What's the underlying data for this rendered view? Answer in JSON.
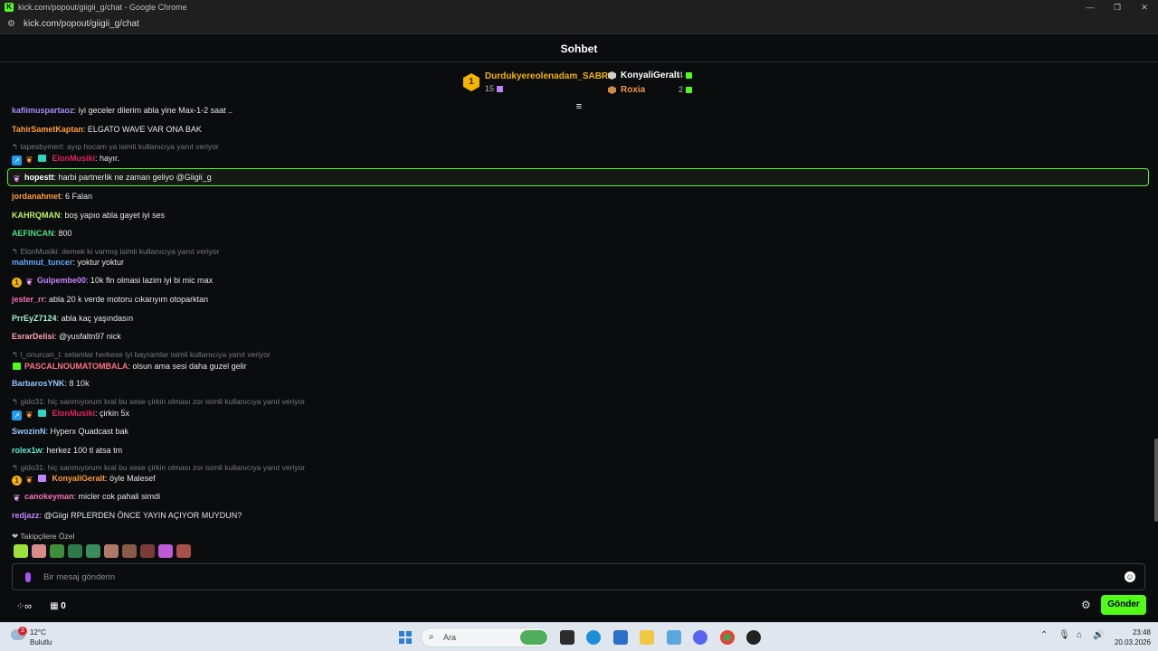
{
  "browser": {
    "window_title": "kick.com/popout/giigii_g/chat - Google Chrome",
    "url": "kick.com/popout/giigii_g/chat",
    "minimize": "—",
    "restore": "❐",
    "close": "✕",
    "favicon": "K"
  },
  "chat": {
    "header": "Sohbet",
    "leaderboard": {
      "first": {
        "rank": "1",
        "name": "Durdukyereolenadam_SABRI",
        "count": "15"
      },
      "second": {
        "name": "KonyaliGeralt",
        "count": "4"
      },
      "third": {
        "name": "Roxia",
        "count": "2"
      }
    },
    "messages": [
      {
        "user": "kafiimuspartaoz",
        "text": "iyi geceler dilerim abla yine Max-1-2 saat ..",
        "color": "#a78bfa"
      },
      {
        "user": "TahirSametKaptan",
        "text": "ELGATO WAVE VAR ONA BAK",
        "color": "#ff9b3d"
      },
      {
        "reply": "tapesbymert: ayıp hocam ya isimli kullanıcıya yanıt veriyor"
      },
      {
        "user": "ElonMusiki",
        "text": "hayır.",
        "color": "#e0245e"
      },
      {
        "user": "hopestt",
        "text": "harbi partnerlik ne zaman geliyo @Giigii_g",
        "color": "#ffffff"
      },
      {
        "user": "jordanahmet",
        "text": "6 Falan",
        "color": "#ff9b3d"
      },
      {
        "user": "KAHRQMAN",
        "text": "boş yapıo abla gayet iyi ses",
        "color": "#bef264"
      },
      {
        "user": "AEFINCAN",
        "text": "800",
        "color": "#4ade80"
      },
      {
        "reply": "ElonMusiki: demek ki varmış isimli kullanıcıya yanıt veriyor"
      },
      {
        "user": "mahmut_tuncer",
        "text": "yoktur yoktur",
        "color": "#60a5fa"
      },
      {
        "user": "Gulpembe00",
        "text": "10k fln olmasi lazim iyi bi mic max",
        "color": "#c084fc"
      },
      {
        "user": "jester_rr",
        "text": "abla 20 k verde motoru cıkarıyım otoparktan",
        "color": "#f472b6"
      },
      {
        "user": "PrrEyZ7124",
        "text": "abla kaç yaşındasın",
        "color": "#a7f3d0"
      },
      {
        "user": "EsrarDelisi",
        "text": "@yusfaltn97 nick",
        "color": "#fda4af"
      },
      {
        "reply": "l_onurcan_l: selamlar herkese iyi bayramlar isimli kullanıcıya yanıt veriyor"
      },
      {
        "user": "PASCALNOUMATOMBALA",
        "text": "olsun ama sesi daha guzel gelir",
        "color": "#fb7185"
      },
      {
        "user": "BarbarosYNK",
        "text": "8 10k",
        "color": "#93c5fd"
      },
      {
        "reply": "gido31: hiç sanmıyorum kral bu sese çirkin olması zor isimli kullanıcıya yanıt veriyor"
      },
      {
        "user": "ElonMusiki",
        "text": "çirkin 5x",
        "color": "#e0245e"
      },
      {
        "user": "SwozinN",
        "text": "Hyperx Quadcast bak",
        "color": "#93c5fd"
      },
      {
        "user": "rolex1w",
        "text": "herkez 100 tl atsa tm",
        "color": "#5eead4"
      },
      {
        "reply": "gido31: hiç sanmıyorum kral bu sese çirkin olması zor isimli kullanıcıya yanıt veriyor"
      },
      {
        "user": "KonyaliGeralt",
        "text": "öyle Malesef",
        "color": "#ff9b3d"
      },
      {
        "user": "canokeyman",
        "text": "micler cok pahali simdi",
        "color": "#f472b6"
      },
      {
        "user": "redjazz",
        "text": "@Giigi RPLERDEN ÖNCE YAYIN AÇIYOR MUYDUN?",
        "color": "#c084fc"
      }
    ],
    "emote_section": "Takipçilere Özel",
    "input_placeholder": "Bir mesaj gönderin",
    "points": "0",
    "send": "Gönder"
  },
  "taskbar": {
    "weather_badge": "1",
    "temperature": "12°C",
    "condition": "Bulutlu",
    "search_label": "Ara",
    "time": "23:48",
    "date": "20.03.2026"
  },
  "colors": {
    "accent": "#53fc18",
    "background": "#0b0c0d"
  }
}
